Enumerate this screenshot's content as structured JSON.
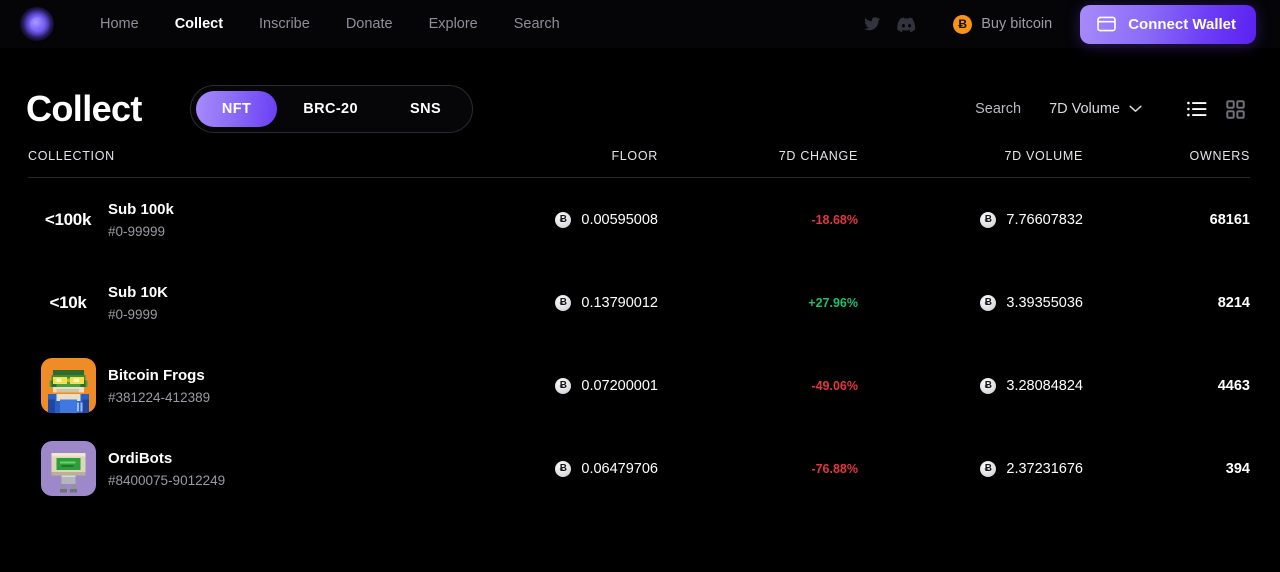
{
  "navbar": {
    "logo_name": "ordinals-logo",
    "links": [
      {
        "label": "Home",
        "active": false
      },
      {
        "label": "Collect",
        "active": true
      },
      {
        "label": "Inscribe",
        "active": false
      },
      {
        "label": "Donate",
        "active": false
      },
      {
        "label": "Explore",
        "active": false
      },
      {
        "label": "Search",
        "active": false
      }
    ],
    "twitter_icon": "twitter-icon",
    "discord_icon": "discord-icon",
    "btc_symbol": "Ƀ",
    "buy_bitcoin_label": "Buy bitcoin",
    "connect_wallet_label": "Connect Wallet"
  },
  "page": {
    "title": "Collect",
    "tabs": [
      {
        "label": "NFT",
        "active": true
      },
      {
        "label": "BRC-20",
        "active": false
      },
      {
        "label": "SNS",
        "active": false
      }
    ],
    "search_label": "Search",
    "sort_label": "7D Volume",
    "list_view_icon": "list-view-icon",
    "grid_view_icon": "grid-view-icon"
  },
  "table": {
    "headers": {
      "collection": "COLLECTION",
      "floor": "FLOOR",
      "change": "7D CHANGE",
      "volume": "7D VOLUME",
      "owners": "OWNERS"
    },
    "btc_badge_symbol": "Ƀ",
    "rows": [
      {
        "avatar_type": "text",
        "avatar_text": "<100k",
        "avatar_bg": "#000000",
        "name": "Sub 100k",
        "range": "#0-99999",
        "floor": "0.00595008",
        "change": "-18.68%",
        "change_dir": "down",
        "volume": "7.76607832",
        "owners": "68161"
      },
      {
        "avatar_type": "text",
        "avatar_text": "<10k",
        "avatar_bg": "#000000",
        "name": "Sub 10K",
        "range": "#0-9999",
        "floor": "0.13790012",
        "change": "+27.96%",
        "change_dir": "up",
        "volume": "3.39355036",
        "owners": "8214"
      },
      {
        "avatar_type": "frog",
        "avatar_text": "",
        "avatar_bg": "#ef8c28",
        "name": "Bitcoin Frogs",
        "range": "#381224-412389",
        "floor": "0.07200001",
        "change": "-49.06%",
        "change_dir": "down",
        "volume": "3.28084824",
        "owners": "4463"
      },
      {
        "avatar_type": "bot",
        "avatar_text": "",
        "avatar_bg": "#9d89c9",
        "name": "OrdiBots",
        "range": "#8400075-9012249",
        "floor": "0.06479706",
        "change": "-76.88%",
        "change_dir": "down",
        "volume": "2.37231676",
        "owners": "394"
      }
    ]
  },
  "colors": {
    "background": "#000000",
    "accent_purple": "#7a5cf7",
    "positive_green": "#1fbf6b",
    "negative_red": "#e0383e",
    "bitcoin_orange": "#f7931a"
  }
}
